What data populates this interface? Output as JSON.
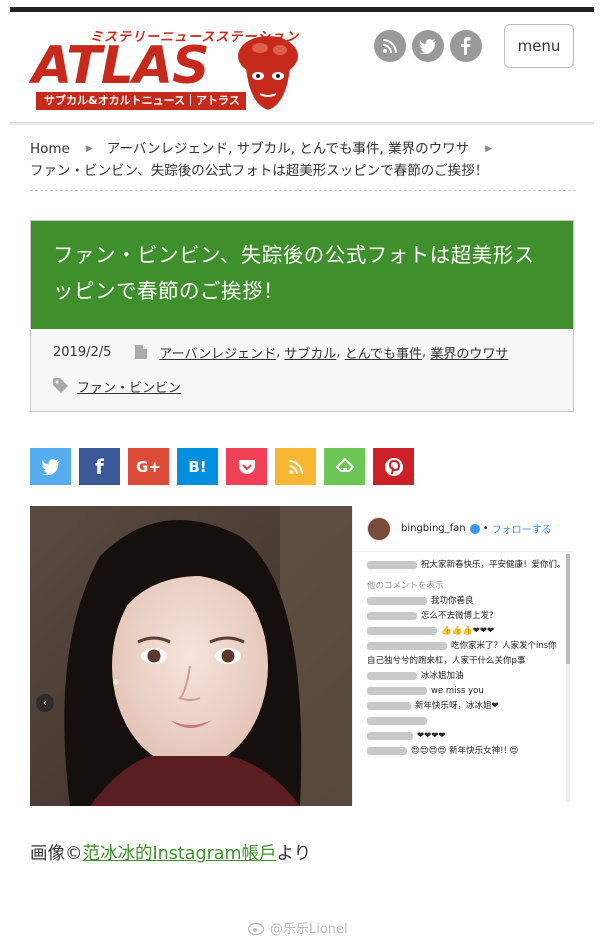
{
  "site": {
    "logo_tagline": "ミステリーニュースステーション",
    "logo_wordmark": "ATLAS",
    "logo_subbar": "サブカル&オカルトニュース｜アトラス",
    "menu_label": "menu",
    "social_icons": [
      "rss-icon",
      "twitter-icon",
      "facebook-icon"
    ]
  },
  "breadcrumb": {
    "home": "Home",
    "categories": "アーバンレジェンド, サブカル, とんでも事件, 業界のウワサ",
    "current": "ファン・ビンビン、失踪後の公式フォトは超美形スッピンで春節のご挨拶！"
  },
  "article": {
    "title": "ファン・ビンビン、失踪後の公式フォトは超美形スッピンで春節のご挨拶！",
    "date": "2019/2/5",
    "categories": [
      "アーバンレジェンド",
      "サブカル",
      "とんでも事件",
      "業界のウワサ"
    ],
    "tag": "ファン・ビンビン"
  },
  "share_buttons": [
    {
      "name": "twitter",
      "label": "",
      "color": "#55acee"
    },
    {
      "name": "facebook",
      "label": "f",
      "color": "#3b5998"
    },
    {
      "name": "google-plus",
      "label": "G+",
      "color": "#dd4b39"
    },
    {
      "name": "hatena",
      "label": "B!",
      "color": "#008fde"
    },
    {
      "name": "pocket",
      "label": "",
      "color": "#ef4056"
    },
    {
      "name": "rss",
      "label": "",
      "color": "#f7b733"
    },
    {
      "name": "feedly",
      "label": "",
      "color": "#6cc655"
    },
    {
      "name": "pinterest",
      "label": "",
      "color": "#cb2027"
    }
  ],
  "instagram": {
    "username": "bingbing_fan",
    "follow_label": "フォローする",
    "caption": "祝大家新春快乐，平安健康！爱你们。",
    "more_comments": "他のコメントを表示",
    "comments": [
      "我功你善良",
      "怎么不去微博上发?",
      "👍👍👍❤❤❤",
      "吃你家米了？人家发个ins你自己独兮兮的跑来杠，人家干什么关你p事",
      "冰冰姐加油",
      "we miss you",
      "新年快乐呀，冰冰姐❤",
      "❤❤❤❤",
      "😍😍😍😍 新年快乐女神!! 😍"
    ]
  },
  "caption": {
    "prefix": "画像©",
    "link": "范冰冰的Instagram帳戶",
    "suffix": "より"
  },
  "watermark": "@乐乐Lionel"
}
